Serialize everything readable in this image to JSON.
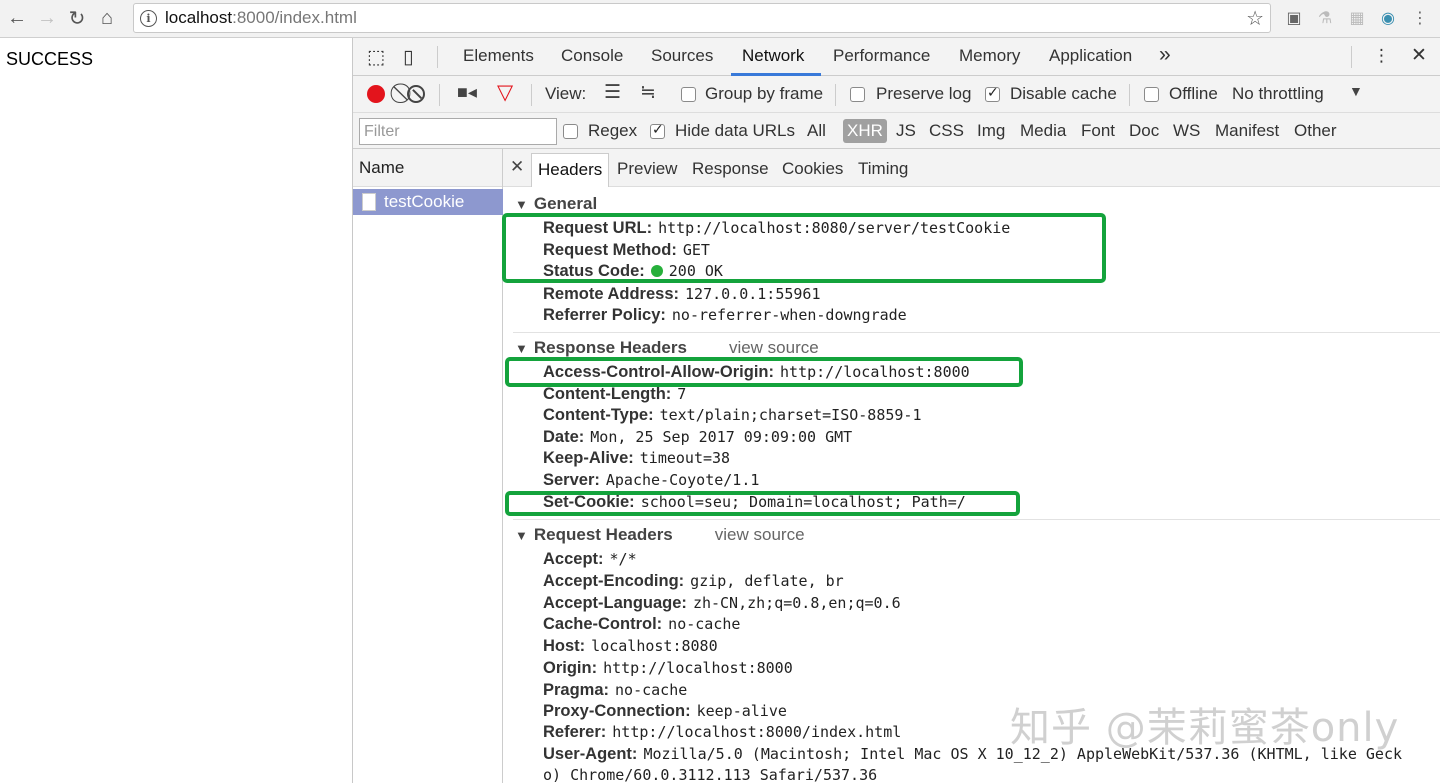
{
  "browser": {
    "url_host": "localhost",
    "url_rest": ":8000/index.html"
  },
  "page": {
    "body_text": "SUCCESS"
  },
  "devtools": {
    "tabs": [
      "Elements",
      "Console",
      "Sources",
      "Network",
      "Performance",
      "Memory",
      "Application"
    ],
    "more_tabs": "»",
    "toolbar": {
      "view_label": "View:",
      "group_by_frame": "Group by frame",
      "preserve_log": "Preserve log",
      "disable_cache": "Disable cache",
      "offline": "Offline",
      "throttling": "No throttling"
    },
    "filterbar": {
      "filter_placeholder": "Filter",
      "regex": "Regex",
      "hide_data_urls": "Hide data URLs",
      "types": [
        "All",
        "XHR",
        "JS",
        "CSS",
        "Img",
        "Media",
        "Font",
        "Doc",
        "WS",
        "Manifest",
        "Other"
      ]
    },
    "name_column": {
      "header": "Name",
      "requests": [
        "testCookie"
      ]
    },
    "detail_tabs": [
      "Headers",
      "Preview",
      "Response",
      "Cookies",
      "Timing"
    ],
    "general": {
      "title": "General",
      "rows": [
        {
          "k": "Request URL:",
          "v": "http://localhost:8080/server/testCookie"
        },
        {
          "k": "Request Method:",
          "v": "GET"
        },
        {
          "k": "Status Code:",
          "v": "200 OK"
        },
        {
          "k": "Remote Address:",
          "v": "127.0.0.1:55961"
        },
        {
          "k": "Referrer Policy:",
          "v": "no-referrer-when-downgrade"
        }
      ]
    },
    "response_headers": {
      "title": "Response Headers",
      "view_source": "view source",
      "rows": [
        {
          "k": "Access-Control-Allow-Origin:",
          "v": "http://localhost:8000"
        },
        {
          "k": "Content-Length:",
          "v": "7"
        },
        {
          "k": "Content-Type:",
          "v": "text/plain;charset=ISO-8859-1"
        },
        {
          "k": "Date:",
          "v": "Mon, 25 Sep 2017 09:09:00 GMT"
        },
        {
          "k": "Keep-Alive:",
          "v": "timeout=38"
        },
        {
          "k": "Server:",
          "v": "Apache-Coyote/1.1"
        },
        {
          "k": "Set-Cookie:",
          "v": "school=seu; Domain=localhost; Path=/"
        }
      ]
    },
    "request_headers": {
      "title": "Request Headers",
      "view_source": "view source",
      "rows": [
        {
          "k": "Accept:",
          "v": "*/*"
        },
        {
          "k": "Accept-Encoding:",
          "v": "gzip, deflate, br"
        },
        {
          "k": "Accept-Language:",
          "v": "zh-CN,zh;q=0.8,en;q=0.6"
        },
        {
          "k": "Cache-Control:",
          "v": "no-cache"
        },
        {
          "k": "Host:",
          "v": "localhost:8080"
        },
        {
          "k": "Origin:",
          "v": "http://localhost:8000"
        },
        {
          "k": "Pragma:",
          "v": "no-cache"
        },
        {
          "k": "Proxy-Connection:",
          "v": "keep-alive"
        },
        {
          "k": "Referer:",
          "v": "http://localhost:8000/index.html"
        },
        {
          "k": "User-Agent:",
          "v": "Mozilla/5.0 (Macintosh; Intel Mac OS X 10_12_2) AppleWebKit/537.36 (KHTML, like Geck"
        }
      ],
      "wrap_line": "o) Chrome/60.0.3112.113 Safari/537.36"
    }
  },
  "watermark": "知乎 @茉莉蜜茶only",
  "colors": {
    "highlight": "#14a33c",
    "selected_row": "#8d98cf",
    "status_ok": "#27b03b",
    "tab_accent": "#3879d9"
  }
}
